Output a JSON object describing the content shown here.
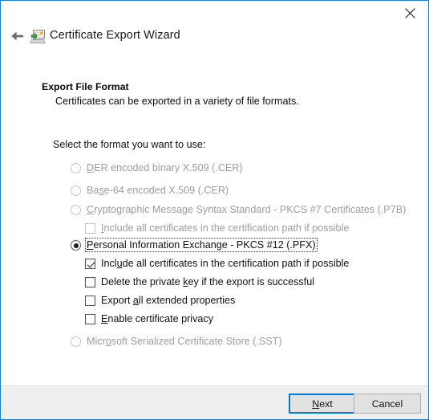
{
  "window": {
    "title": "Certificate Export Wizard",
    "icon": "certificate-icon",
    "back_icon": "back-arrow-icon",
    "close_icon": "close-icon",
    "border_color": "#1a7fd4"
  },
  "header": {
    "title": "Export File Format",
    "subtitle": "Certificates can be exported in a variety of file formats."
  },
  "main": {
    "prompt": "Select the format you want to use:",
    "options": [
      {
        "id": "der",
        "type": "radio",
        "label": "DER encoded binary X.509 (.CER)",
        "accesskey": "D",
        "checked": false,
        "enabled": false,
        "focused": false,
        "indent": 0
      },
      {
        "id": "base64",
        "type": "radio",
        "label": "Base-64 encoded X.509 (.CER)",
        "accesskey": "s",
        "checked": false,
        "enabled": false,
        "focused": false,
        "indent": 0
      },
      {
        "id": "pkcs7",
        "type": "radio",
        "label": "Cryptographic Message Syntax Standard - PKCS #7 Certificates (.P7B)",
        "accesskey": "C",
        "checked": false,
        "enabled": false,
        "focused": false,
        "indent": 0
      },
      {
        "id": "pkcs7-include-all",
        "type": "checkbox",
        "label": "Include all certificates in the certification path if possible",
        "accesskey": "I",
        "checked": false,
        "enabled": false,
        "focused": false,
        "indent": 1
      },
      {
        "id": "pfx",
        "type": "radio",
        "label": "Personal Information Exchange - PKCS #12 (.PFX)",
        "accesskey": "P",
        "checked": true,
        "enabled": true,
        "focused": true,
        "indent": 0
      },
      {
        "id": "pfx-include-all",
        "type": "checkbox",
        "label": "Include all certificates in the certification path if possible",
        "accesskey": "u",
        "checked": true,
        "enabled": true,
        "focused": false,
        "indent": 1
      },
      {
        "id": "pfx-delete-key",
        "type": "checkbox",
        "label": "Delete the private key if the export is successful",
        "accesskey": "k",
        "checked": false,
        "enabled": true,
        "focused": false,
        "indent": 1
      },
      {
        "id": "pfx-export-ext",
        "type": "checkbox",
        "label": "Export all extended properties",
        "accesskey": "a",
        "checked": false,
        "enabled": true,
        "focused": false,
        "indent": 1
      },
      {
        "id": "pfx-privacy",
        "type": "checkbox",
        "label": "Enable certificate privacy",
        "accesskey": "E",
        "checked": false,
        "enabled": true,
        "focused": false,
        "indent": 1
      },
      {
        "id": "sst",
        "type": "radio",
        "label": "Microsoft Serialized Certificate Store (.SST)",
        "accesskey": "o",
        "checked": false,
        "enabled": false,
        "focused": false,
        "indent": 0
      }
    ]
  },
  "footer": {
    "next_label": "Next",
    "next_accesskey": "N",
    "cancel_label": "Cancel",
    "default_button": "next",
    "default_border_color": "#0078d7"
  }
}
